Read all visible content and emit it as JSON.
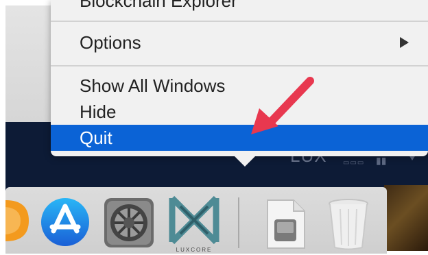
{
  "menu": {
    "items_top_cut": "Blockchain Explorer",
    "items": [
      {
        "label": "Options",
        "has_submenu": true,
        "selected": false
      },
      {
        "label": "Show All Windows",
        "selected": false
      },
      {
        "label": "Hide",
        "selected": false
      },
      {
        "label": "Quit",
        "selected": true
      }
    ]
  },
  "menubar": {
    "app_text": "LUX"
  },
  "dock": {
    "apps": [
      {
        "icon": "books-icon"
      },
      {
        "icon": "app-store-icon"
      },
      {
        "icon": "system-preferences-icon"
      },
      {
        "icon": "luxcore-icon",
        "label": "LUXCORE"
      },
      {
        "icon": "document-icon"
      },
      {
        "icon": "trash-icon"
      }
    ]
  },
  "colors": {
    "selection": "#0b63d6",
    "menu_bg": "#f1f1f1",
    "dark_band": "#0d1b36",
    "annotation_arrow": "#e8384f"
  }
}
